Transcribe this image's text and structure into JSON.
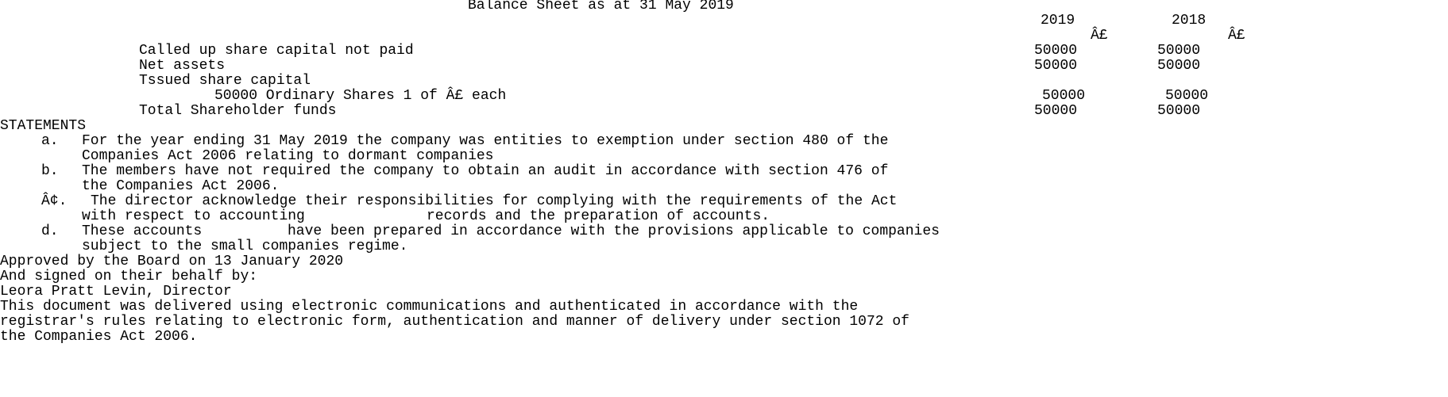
{
  "title": "Balance Sheet as at 31 May 2019",
  "columns": {
    "year_2019": "2019",
    "year_2018": "2018",
    "currency_2019": "Â£",
    "currency_2018": "Â£"
  },
  "rows": [
    {
      "label": "Called up share capital not paid",
      "v2019": "50000",
      "v2018": "50000"
    },
    {
      "label": "Net assets",
      "v2019": "50000",
      "v2018": "50000"
    },
    {
      "label": "Tssued share capital"
    },
    {
      "label": "50000 Ordinary Shares 1 of Â£ each",
      "v2019": "50000",
      "v2018": "50000"
    },
    {
      "label": "Total Shareholder funds",
      "v2019": "50000",
      "v2018": "50000"
    }
  ],
  "statements": {
    "heading": "STATEMENTS",
    "items": [
      {
        "marker": "a.",
        "line1": "For the year ending 31 May 2019 the company was entities to exemption under section 480 of the",
        "line2": "Companies Act 2006 relating to dormant companies"
      },
      {
        "marker": "b.",
        "line1": "The members have not required the company to obtain an audit in accordance with section 476 of",
        "line2": "the Companies Act 2006."
      },
      {
        "marker": "Â¢.",
        "line1": "The director acknowledge their responsibilities for complying with the requirements of the Act",
        "line2a": "with respect to accounting",
        "line2b": "records and the preparation of accounts."
      },
      {
        "marker": "d.",
        "line1a": "These accounts",
        "line1b": "have been prepared in accordance with the provisions applicable to companies",
        "line2": "subject to the small companies regime."
      }
    ]
  },
  "approval": {
    "approved": "Approved by the Board on 13 January 2020",
    "signed": "And signed on their behalf by:",
    "director": "Leora Pratt Levin, Director"
  },
  "footer": {
    "line1": "This document was delivered using electronic communications and authenticated in accordance with the",
    "line2": "registrar's rules relating to electronic form, authentication and manner of delivery under section 1072 of",
    "line3": "the Companies Act 2006."
  }
}
